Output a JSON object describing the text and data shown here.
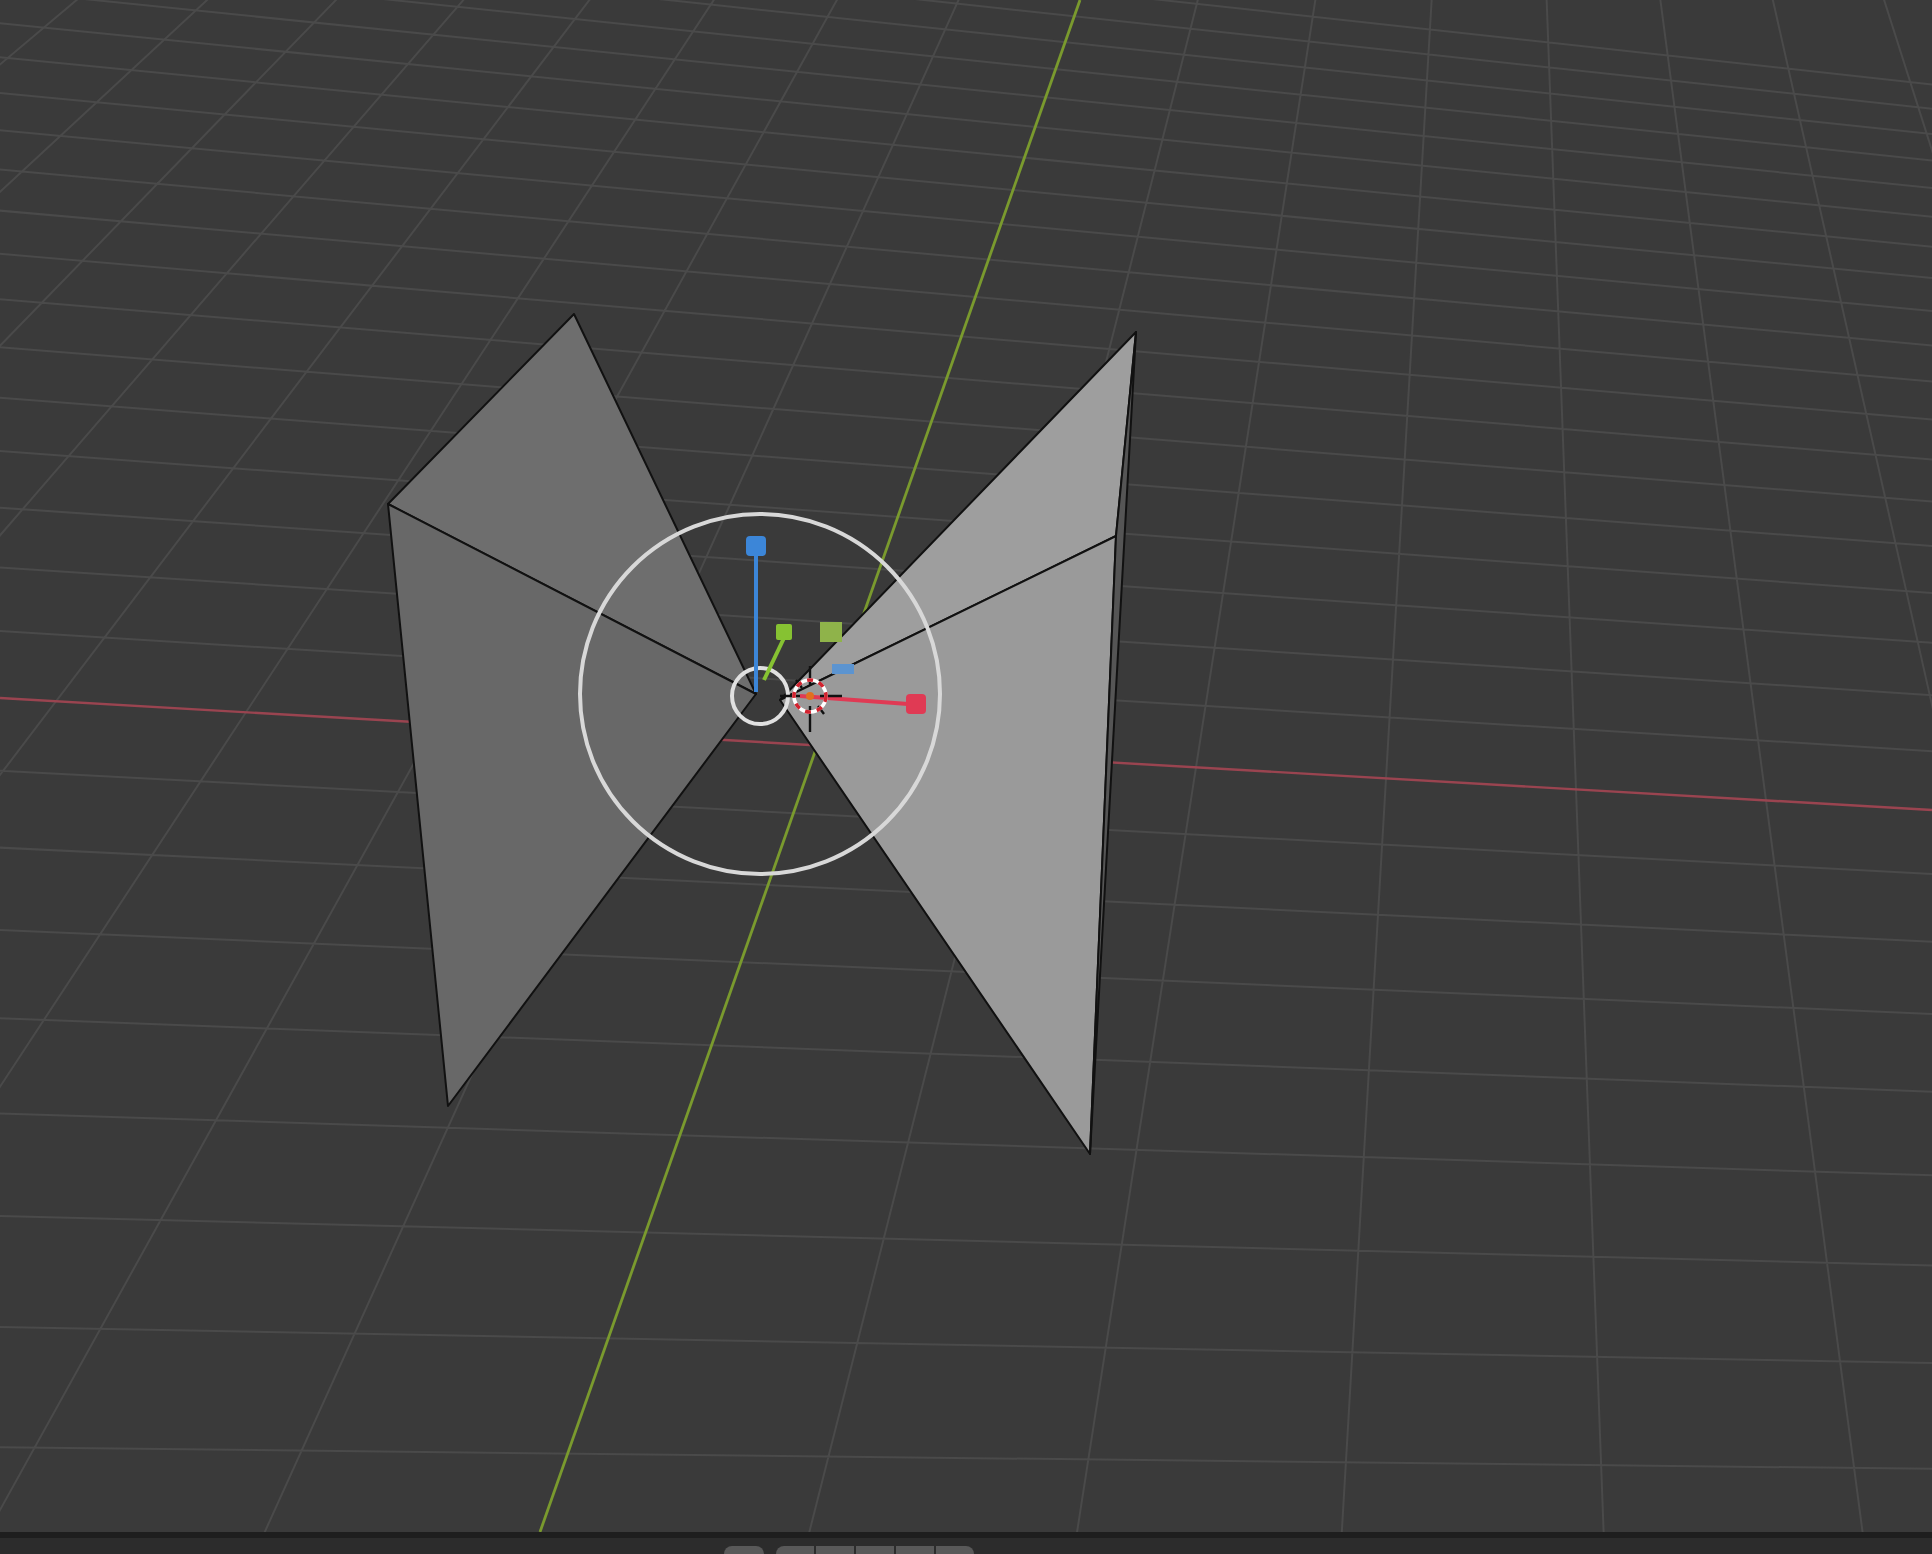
{
  "viewport": {
    "objects": [
      {
        "kind": "bowtie-mesh"
      }
    ],
    "gizmo": {
      "kind": "transform"
    },
    "cursor": {
      "kind": "crosshair"
    }
  },
  "bottom_bar": {
    "buttons": [
      {
        "kind": "single"
      },
      {
        "kind": "segment"
      },
      {
        "kind": "segment"
      },
      {
        "kind": "segment"
      },
      {
        "kind": "segment"
      },
      {
        "kind": "segment"
      }
    ]
  }
}
